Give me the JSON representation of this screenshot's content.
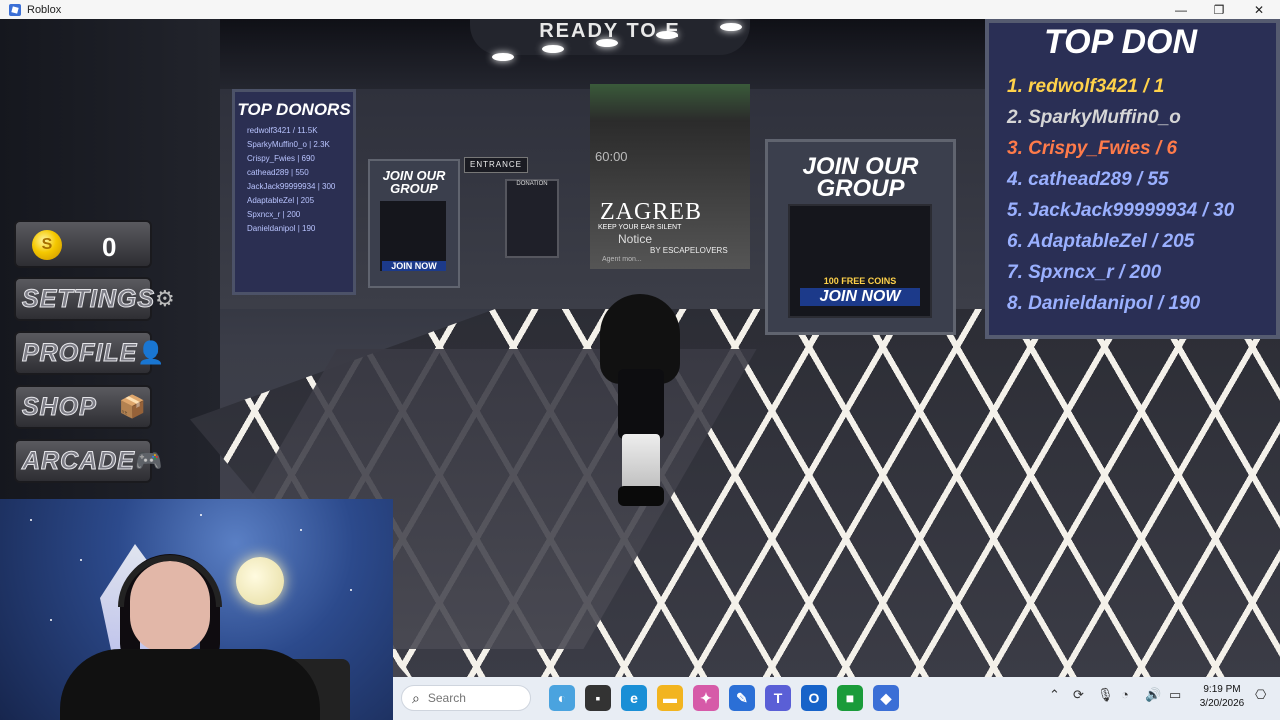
{
  "window": {
    "title": "Roblox",
    "controls": {
      "minimize": "—",
      "maximize": "❐",
      "close": "✕"
    }
  },
  "game": {
    "hud": {
      "coins": "0",
      "coin_symbol": "S",
      "buttons": [
        {
          "label": "SETTINGS",
          "icon": "gear-icon"
        },
        {
          "label": "PROFILE",
          "icon": "person-icon"
        },
        {
          "label": "SHOP",
          "icon": "box-icon"
        },
        {
          "label": "ARCADE",
          "icon": "gamepad-icon"
        }
      ]
    },
    "ceiling_sign": "READY TO E",
    "top_donors_board": {
      "heading": "TOP DON",
      "entries": [
        "1. redwolf3421 / 1",
        "2. SparkyMuffin0_o",
        "3. Crispy_Fwies / 6",
        "4. cathead289 / 55",
        "5. JackJack99999934 / 30",
        "6. AdaptableZel / 205",
        "7. Spxncx_r / 200",
        "8. Danieldanipol / 190"
      ],
      "colors": {
        "first": "#ffd24a",
        "second": "#d6d6d6",
        "third": "#ff7b4a",
        "rest": "#9ab0ff"
      }
    },
    "top_donors_small": {
      "heading": "TOP DONORS",
      "entries": [
        "redwolf3421 / 11.5K",
        "SparkyMuffin0_o | 2.3K",
        "Crispy_Fwies | 690",
        "cathead289 | 550",
        "JackJack99999934 | 300",
        "AdaptableZel | 205",
        "Spxncx_r | 200",
        "Danieldanipol | 190"
      ]
    },
    "join_group_big": {
      "heading_line1": "JOIN OUR",
      "heading_line2": "GROUP",
      "coins_text": "100 FREE COINS",
      "button": "JOIN NOW"
    },
    "join_group_small": {
      "heading_line1": "JOIN OUR",
      "heading_line2": "GROUP",
      "button": "JOIN NOW"
    },
    "entrance_sign": "ENTRANCE",
    "donation_board": "DONATION",
    "poster": {
      "clock": "60:00",
      "title": "ZAGREB",
      "tagline": "KEEP YOUR EAR SILENT",
      "notice": "Notice",
      "by": "BY ESCAPELOVERS",
      "agent": "Agent mon..."
    }
  },
  "taskbar": {
    "search_placeholder": "Search",
    "time": "9:19 PM",
    "date": "3/20/2026",
    "apps": [
      {
        "name": "widgets-icon",
        "color": "#4aa3df",
        "glyph": "◐"
      },
      {
        "name": "task-view-icon",
        "color": "#333333",
        "glyph": "▪"
      },
      {
        "name": "edge-icon",
        "color": "#1a8fd6",
        "glyph": "e"
      },
      {
        "name": "file-explorer-icon",
        "color": "#f2b41f",
        "glyph": "▬"
      },
      {
        "name": "copilot-icon",
        "color": "#d65aa8",
        "glyph": "✦"
      },
      {
        "name": "editor-icon",
        "color": "#2b6fd6",
        "glyph": "✎"
      },
      {
        "name": "teams-icon",
        "color": "#5a5fd6",
        "glyph": "T"
      },
      {
        "name": "outlook-icon",
        "color": "#1763c9",
        "glyph": "O"
      },
      {
        "name": "xbox-icon",
        "color": "#1a9b3a",
        "glyph": "■"
      },
      {
        "name": "roblox-icon",
        "color": "#3b6fd6",
        "glyph": "◆"
      }
    ],
    "tray": [
      {
        "name": "chevron-up-icon",
        "glyph": "⌃"
      },
      {
        "name": "sync-icon",
        "glyph": "⟳"
      },
      {
        "name": "microphone-icon",
        "glyph": "🎙"
      },
      {
        "name": "wifi-icon",
        "glyph": "◔"
      },
      {
        "name": "volume-icon",
        "glyph": "🔊"
      },
      {
        "name": "battery-icon",
        "glyph": "▭"
      },
      {
        "name": "notification-icon",
        "glyph": "⎔"
      }
    ]
  }
}
